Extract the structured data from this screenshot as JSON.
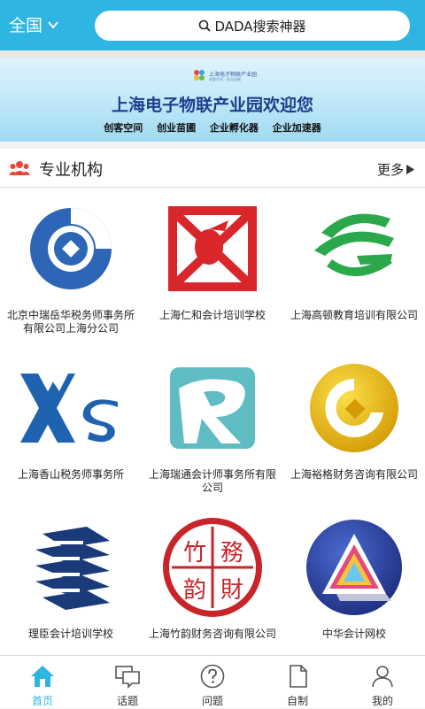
{
  "header": {
    "city": "全国",
    "search_placeholder": "DADA搜索神器"
  },
  "banner": {
    "logo_text": "上海电子物联产业园",
    "logo_sub": "创客空间 · 创业苗圃",
    "title": "上海电子物联产业园欢迎您",
    "tags": [
      "创客空间",
      "创业苗圃",
      "企业孵化器",
      "企业加速器"
    ]
  },
  "section": {
    "title": "专业机构",
    "more_label": "更多"
  },
  "institutions": [
    {
      "name": "北京中瑞岳华税务师事务所有限公司上海分公司",
      "logo": "coin-circle-blue-logo"
    },
    {
      "name": "上海仁和会计培训学校",
      "logo": "red-square-logo"
    },
    {
      "name": "上海高顿教育培训有限公司",
      "logo": "green-g-logo"
    },
    {
      "name": "上海香山税务师事务所",
      "logo": "xs-blue-logo"
    },
    {
      "name": "上海瑞通会计师事务所有限公司",
      "logo": "teal-r-logo"
    },
    {
      "name": "上海裕格财务咨询有限公司",
      "logo": "gold-coin-logo"
    },
    {
      "name": "理臣会计培训学校",
      "logo": "blue-stack-logo"
    },
    {
      "name": "上海竹韵财务咨询有限公司",
      "logo": "red-seal-logo"
    },
    {
      "name": "中华会计网校",
      "logo": "purple-triangle-logo"
    }
  ],
  "seal_text": "竹務韵財",
  "tabs": [
    {
      "label": "首页",
      "icon": "home-icon",
      "active": true
    },
    {
      "label": "话题",
      "icon": "chat-icon",
      "active": false
    },
    {
      "label": "问题",
      "icon": "question-icon",
      "active": false
    },
    {
      "label": "自制",
      "icon": "document-icon",
      "active": false
    },
    {
      "label": "我的",
      "icon": "user-icon",
      "active": false
    }
  ],
  "colors": {
    "accent": "#2fb5e2",
    "banner_title": "#1c3f8c"
  }
}
